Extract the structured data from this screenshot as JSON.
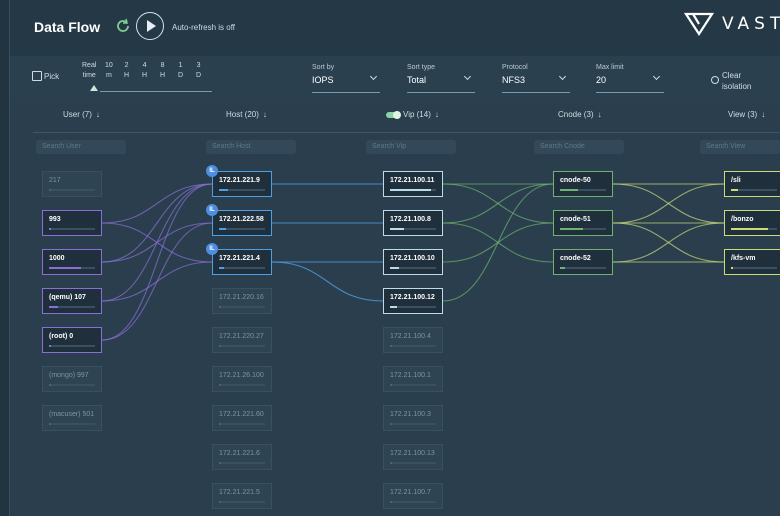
{
  "app": {
    "title": "Data Flow",
    "auto_refresh": "Auto-refresh is off",
    "logo_text": "VAST"
  },
  "controls": {
    "pick_label": "Pick",
    "time_ticks": [
      {
        "top": "Real",
        "bottom": "time"
      },
      {
        "top": "10",
        "bottom": "m"
      },
      {
        "top": "2",
        "bottom": "H"
      },
      {
        "top": "4",
        "bottom": "H"
      },
      {
        "top": "8",
        "bottom": "H"
      },
      {
        "top": "1",
        "bottom": "D"
      },
      {
        "top": "3",
        "bottom": "D"
      }
    ],
    "sort_by": {
      "label": "Sort by",
      "value": "IOPS"
    },
    "sort_type": {
      "label": "Sort type",
      "value": "Total"
    },
    "protocol": {
      "label": "Protocol",
      "value": "NFS3"
    },
    "max_limit": {
      "label": "Max limit",
      "value": "20"
    },
    "clear_isolation": {
      "line1": "Clear",
      "line2": "isolation"
    }
  },
  "columns": {
    "user": {
      "header": "User (7)",
      "search": "Search User"
    },
    "host": {
      "header": "Host (20)",
      "search": "Search Host"
    },
    "vip": {
      "header": "Vip (14)",
      "search": "Search Vip"
    },
    "cnode": {
      "header": "Cnode (3)",
      "search": "Search Cnode"
    },
    "view": {
      "header": "View (3)",
      "search": "Search View"
    }
  },
  "users": [
    {
      "label": "217",
      "active": false,
      "fill": 0.05
    },
    {
      "label": "993",
      "active": true,
      "fill": 0.05
    },
    {
      "label": "1000",
      "active": true,
      "fill": 0.7
    },
    {
      "label": "(qemu) 107",
      "active": true,
      "fill": 0.2
    },
    {
      "label": "(root) 0",
      "active": true,
      "fill": 0.05
    },
    {
      "label": "(mongo) 997",
      "active": false,
      "fill": 0.05
    },
    {
      "label": "(macuser) 501",
      "active": false,
      "fill": 0.05
    }
  ],
  "hosts": [
    {
      "label": "172.21.221.9",
      "active": true,
      "fill": 0.2,
      "badge": "IL"
    },
    {
      "label": "172.21.222.58",
      "active": true,
      "fill": 0.15,
      "badge": "IL"
    },
    {
      "label": "172.21.221.4",
      "active": true,
      "fill": 0.1,
      "badge": "IL"
    },
    {
      "label": "172.21.220.16",
      "active": false,
      "fill": 0.05
    },
    {
      "label": "172.21.220.27",
      "active": false,
      "fill": 0.05
    },
    {
      "label": "172.21.26.100",
      "active": false,
      "fill": 0.05
    },
    {
      "label": "172.21.221.60",
      "active": false,
      "fill": 0.05
    },
    {
      "label": "172.21.221.6",
      "active": false,
      "fill": 0.05
    },
    {
      "label": "172.21.221.5",
      "active": false,
      "fill": 0.05
    }
  ],
  "vips": [
    {
      "label": "172.21.100.11",
      "active": true,
      "fill": 0.9
    },
    {
      "label": "172.21.100.8",
      "active": true,
      "fill": 0.3
    },
    {
      "label": "172.21.100.10",
      "active": true,
      "fill": 0.2
    },
    {
      "label": "172.21.100.12",
      "active": true,
      "fill": 0.15
    },
    {
      "label": "172.21.100.4",
      "active": false,
      "fill": 0.05
    },
    {
      "label": "172.21.100.1",
      "active": false,
      "fill": 0.05
    },
    {
      "label": "172.21.100.3",
      "active": false,
      "fill": 0.05
    },
    {
      "label": "172.21.100.13",
      "active": false,
      "fill": 0.05
    },
    {
      "label": "172.21.100.7",
      "active": false,
      "fill": 0.05
    }
  ],
  "cnodes": [
    {
      "label": "cnode-50",
      "active": true,
      "fill": 0.4
    },
    {
      "label": "cnode-51",
      "active": true,
      "fill": 0.5
    },
    {
      "label": "cnode-52",
      "active": true,
      "fill": 0.1
    }
  ],
  "views": [
    {
      "label": "/sli",
      "active": true,
      "fill": 0.15
    },
    {
      "label": "/bonzo",
      "active": true,
      "fill": 0.8
    },
    {
      "label": "/kfs-vm",
      "active": true,
      "fill": 0.05
    }
  ],
  "colors": {
    "user": "#8b6fd6",
    "host": "#4e9fe3",
    "vip": "#b9dde8",
    "cnode": "#6eb36f",
    "view": "#c9dc7a"
  }
}
